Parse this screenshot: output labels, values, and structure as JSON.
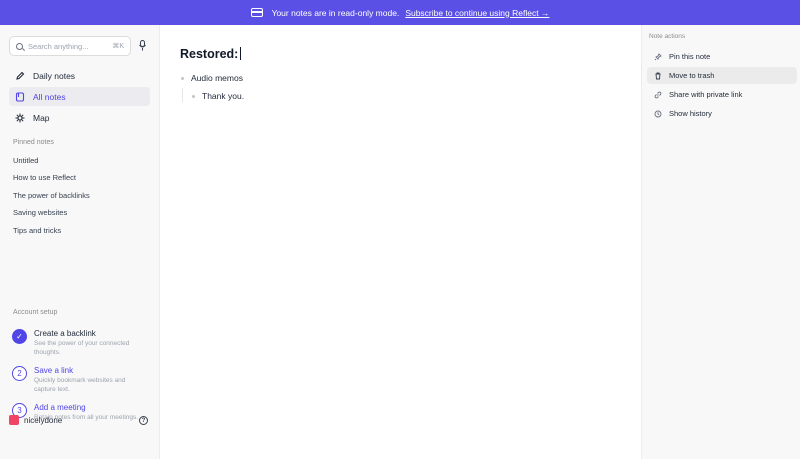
{
  "banner": {
    "message": "Your notes are in read-only mode.",
    "link": "Subscribe to continue using Reflect →"
  },
  "sidebar": {
    "search_placeholder": "Search anything...",
    "search_shortcut": "⌘K",
    "nav": [
      {
        "label": "Daily notes",
        "icon": "pencil-icon"
      },
      {
        "label": "All notes",
        "icon": "notes-icon",
        "active": true
      },
      {
        "label": "Map",
        "icon": "map-icon"
      }
    ],
    "pinned_label": "Pinned notes",
    "pinned": [
      "Untitled",
      "How to use Reflect",
      "The power of backlinks",
      "Saving websites",
      "Tips and tricks"
    ],
    "account_setup_label": "Account setup",
    "setup": [
      {
        "step": "✓",
        "title": "Create a backlink",
        "desc": "See the power of your connected thoughts.",
        "done": true
      },
      {
        "step": "2",
        "title": "Save a link",
        "desc": "Quickly bookmark websites and capture text.",
        "done": false
      },
      {
        "step": "3",
        "title": "Add a meeting",
        "desc": "Retain notes from all your meetings.",
        "done": false
      }
    ],
    "username": "nicelydone",
    "help": "?"
  },
  "note": {
    "title": "Restored:",
    "bullets": [
      {
        "text": "Audio memos"
      },
      {
        "text": "Thank you."
      }
    ]
  },
  "actions": {
    "label": "Note actions",
    "items": [
      {
        "label": "Pin this note",
        "icon": "pin-icon"
      },
      {
        "label": "Move to trash",
        "icon": "trash-icon"
      },
      {
        "label": "Share with private link",
        "icon": "link-icon"
      },
      {
        "label": "Show history",
        "icon": "history-icon"
      }
    ]
  },
  "colors": {
    "accent": "#5b50e6",
    "link": "#4f46e5",
    "avatar": "#ef4467"
  }
}
